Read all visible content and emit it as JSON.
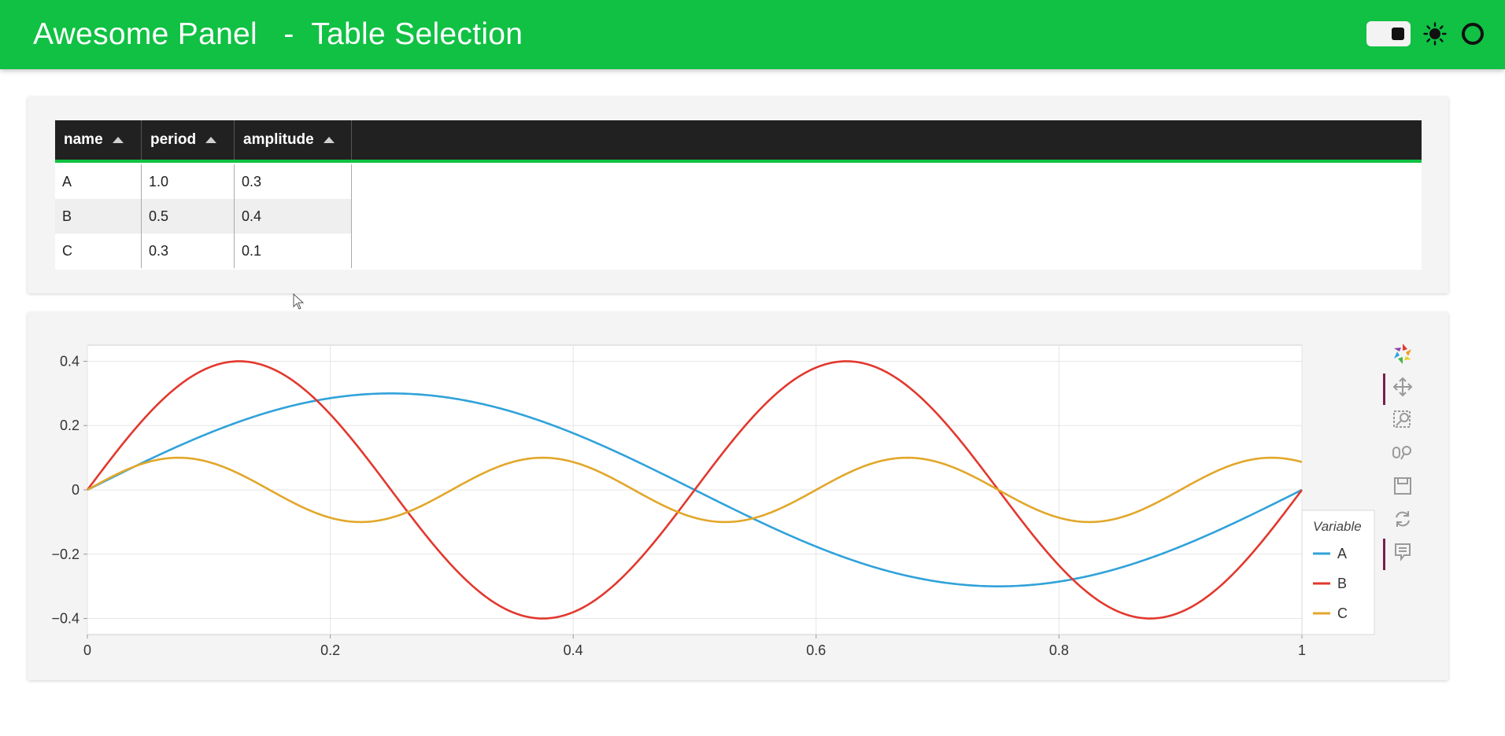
{
  "header": {
    "title": "Awesome Panel   -  Table Selection",
    "background": "#10c143"
  },
  "table": {
    "columns": [
      "name",
      "period",
      "amplitude"
    ],
    "rows": [
      [
        "A",
        "1.0",
        "0.3"
      ],
      [
        "B",
        "0.5",
        "0.4"
      ],
      [
        "C",
        "0.3",
        "0.1"
      ]
    ]
  },
  "chart_data": {
    "type": "line",
    "xlim": [
      0,
      1
    ],
    "ylim": [
      -0.45,
      0.45
    ],
    "x_ticks": [
      "0",
      "0.2",
      "0.4",
      "0.6",
      "0.8",
      "1"
    ],
    "y_ticks": [
      "0.4",
      "0.2",
      "0",
      "−0.2",
      "−0.4"
    ],
    "grid": true,
    "legend_title": "Variable",
    "legend_position": "right",
    "series": [
      {
        "name": "A",
        "color": "#30a2da",
        "period": 1.0,
        "amplitude": 0.3,
        "formula": "amplitude*sin(2*pi*x/period)"
      },
      {
        "name": "B",
        "color": "#e2382d",
        "period": 0.5,
        "amplitude": 0.4,
        "formula": "amplitude*sin(2*pi*x/period)"
      },
      {
        "name": "C",
        "color": "#e2a72a",
        "period": 0.3,
        "amplitude": 0.1,
        "formula": "amplitude*sin(2*pi*x/period)"
      }
    ]
  },
  "toolbar": {
    "tools": [
      "bokeh-logo-icon",
      "pan-icon",
      "box-zoom-icon",
      "wheel-zoom-icon",
      "save-icon",
      "reset-icon",
      "hover-icon"
    ]
  }
}
